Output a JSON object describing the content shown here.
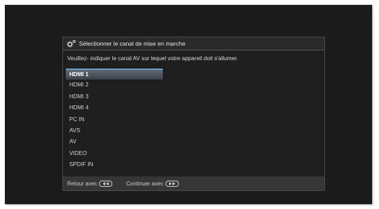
{
  "dialog": {
    "title": "Sélectionner le canal de mise en marche",
    "title_icon": "gear-icon",
    "instruction": "Veuillez- indiquer le canal AV sur lequel votre appareil doit s'allumer.",
    "channels": [
      "HDMI 1",
      "HDMI 2",
      "HDMI 3",
      "HDMI 4",
      "PC IN",
      "AVS",
      "AV",
      "VIDEO",
      "SPDIF IN"
    ],
    "selected_channel": "HDMI 1",
    "footer": {
      "back_label": "Retour avec",
      "back_icon": "rewind-button-icon",
      "continue_label": "Continuer avec",
      "continue_icon": "fast-forward-button-icon"
    }
  },
  "colors": {
    "screen_background": "#1b1b1b",
    "dialog_body": "#1e1e1e",
    "selection_accent": "#6a9fc9"
  }
}
